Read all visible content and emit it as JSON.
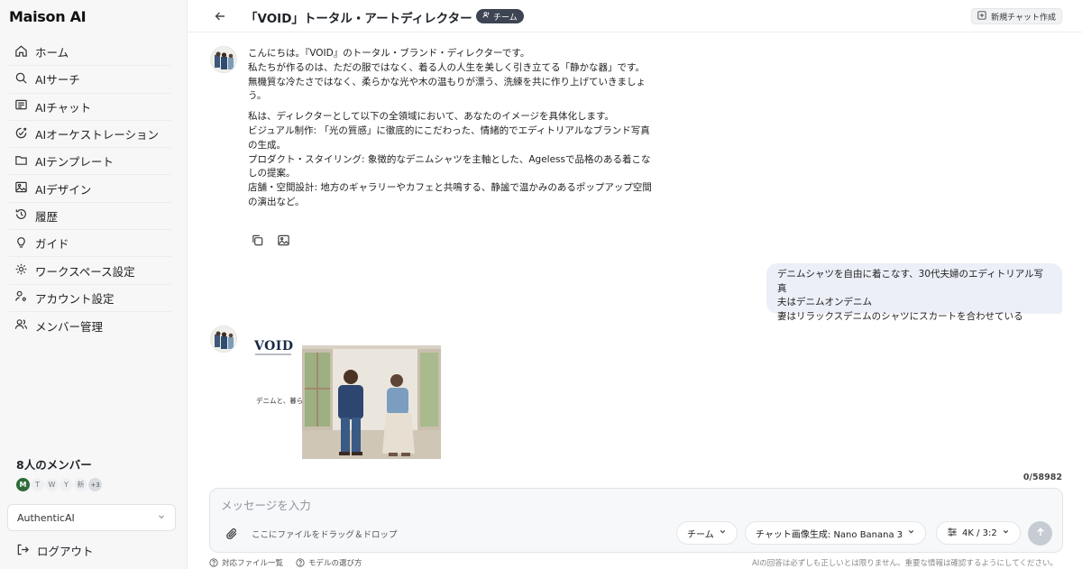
{
  "sidebar": {
    "brand": "Maison AI",
    "items": [
      {
        "label": "ホーム",
        "icon": "home-icon"
      },
      {
        "label": "AIサーチ",
        "icon": "search-icon"
      },
      {
        "label": "AIチャット",
        "icon": "chat-icon"
      },
      {
        "label": "AIオーケストレーション",
        "icon": "orchestration-icon"
      },
      {
        "label": "AIテンプレート",
        "icon": "folder-icon"
      },
      {
        "label": "AIデザイン",
        "icon": "image-icon"
      },
      {
        "label": "履歴",
        "icon": "history-icon"
      },
      {
        "label": "ガイド",
        "icon": "bulb-icon"
      },
      {
        "label": "ワークスペース設定",
        "icon": "gear-icon"
      },
      {
        "label": "アカウント設定",
        "icon": "user-settings-icon"
      },
      {
        "label": "メンバー管理",
        "icon": "users-icon"
      }
    ],
    "members_title": "8人のメンバー",
    "member_initials": [
      "M",
      "T",
      "W",
      "Y",
      "新"
    ],
    "members_more": "+3",
    "workspace_name": "AuthenticAI",
    "logout_label": "ログアウト"
  },
  "header": {
    "title": "「VOID」トータル・アートディレクター",
    "badge": "チーム",
    "new_chat_label": "新規チャット作成"
  },
  "assistant_message": {
    "paragraph1": [
      "こんにちは。『VOID』のトータル・ブランド・ディレクターです。",
      "私たちが作るのは、ただの服ではなく、着る人の人生を美しく引き立てる「静かな器」です。",
      "無機質な冷たさではなく、柔らかな光や木の温もりが漂う、洗練を共に作り上げていきましょ",
      "う。"
    ],
    "paragraph2": [
      "私は、ディレクターとして以下の全領域において、あなたのイメージを具体化します。",
      "ビジュアル制作: 「光の質感」に徹底的にこだわった、情緒的でエディトリアルなブランド写真",
      "の生成。",
      "プロダクト・スタイリング: 象徴的なデニムシャツを主軸とした、Agelessで品格のある着こな",
      "しの提案。",
      "店舗・空間設計: 地方のギャラリーやカフェと共鳴する、静謐で温かみのあるポップアップ空間",
      "の演出など。"
    ]
  },
  "user_message": {
    "lines": [
      "デニムシャツを自由に着こなす、30代夫婦のエディトリアル写真",
      "夫はデニムオンデニム",
      "妻はリラックスデニムのシャツにスカートを合わせている"
    ]
  },
  "generated": {
    "logo": "VOID",
    "copy": "デニムと、暮らす。"
  },
  "composer": {
    "counter": "0/58982",
    "placeholder": "メッセージを入力",
    "drop_hint": "ここにファイルをドラッグ＆ドロップ",
    "team_label": "チーム",
    "model_label": "チャット画像生成: Nano Banana 3",
    "size_label": "4K / 3:2"
  },
  "footer": {
    "files_link": "対応ファイル一覧",
    "model_link": "モデルの選び方",
    "disclaimer": "AIの回答は必ずしも正しいとは限りません。重要な情報は確認するようにしてください。"
  }
}
